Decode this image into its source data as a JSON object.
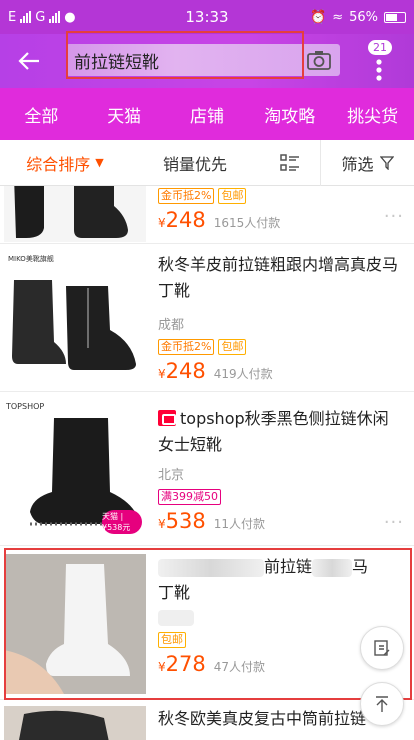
{
  "status": {
    "carrier": "E",
    "network": "G",
    "time": "13:33",
    "battery_pct": "56%"
  },
  "search": {
    "query": "前拉链短靴",
    "notif_count": "21"
  },
  "tabs": [
    "全部",
    "天猫",
    "店铺",
    "淘攻略",
    "挑尖货"
  ],
  "sort": {
    "active": "综合排序",
    "sales": "销量优先",
    "filter": "筛选"
  },
  "items": [
    {
      "tags": [
        "金币抵2%",
        "包邮"
      ],
      "price": "248",
      "paid": "1615人付款"
    },
    {
      "shop_logo": "MIKO美靴旗舰",
      "title": "秋冬羊皮前拉链粗跟内增高真皮马丁靴",
      "location": "成都",
      "tags": [
        "金币抵2%",
        "包邮"
      ],
      "price": "248",
      "paid": "419人付款"
    },
    {
      "shop_logo": "TOPSHOP",
      "title": "topshop秋季黑色侧拉链休闲女士短靴",
      "location": "北京",
      "tags": [
        "满399减50"
      ],
      "price": "538",
      "paid": "11人付款",
      "img_badge": "天猫 | ¥538元"
    },
    {
      "title_part": "前拉链",
      "title_tail": "马",
      "title_line2": "丁靴",
      "tags": [
        "包邮"
      ],
      "price": "278",
      "paid": "47人付款"
    },
    {
      "title": "秋冬欧美真皮复古中筒前拉链"
    }
  ],
  "currency": "¥",
  "colors": {
    "status_bar": "#b436d6",
    "tabs": "#e02bdc",
    "price": "#ff5000"
  }
}
